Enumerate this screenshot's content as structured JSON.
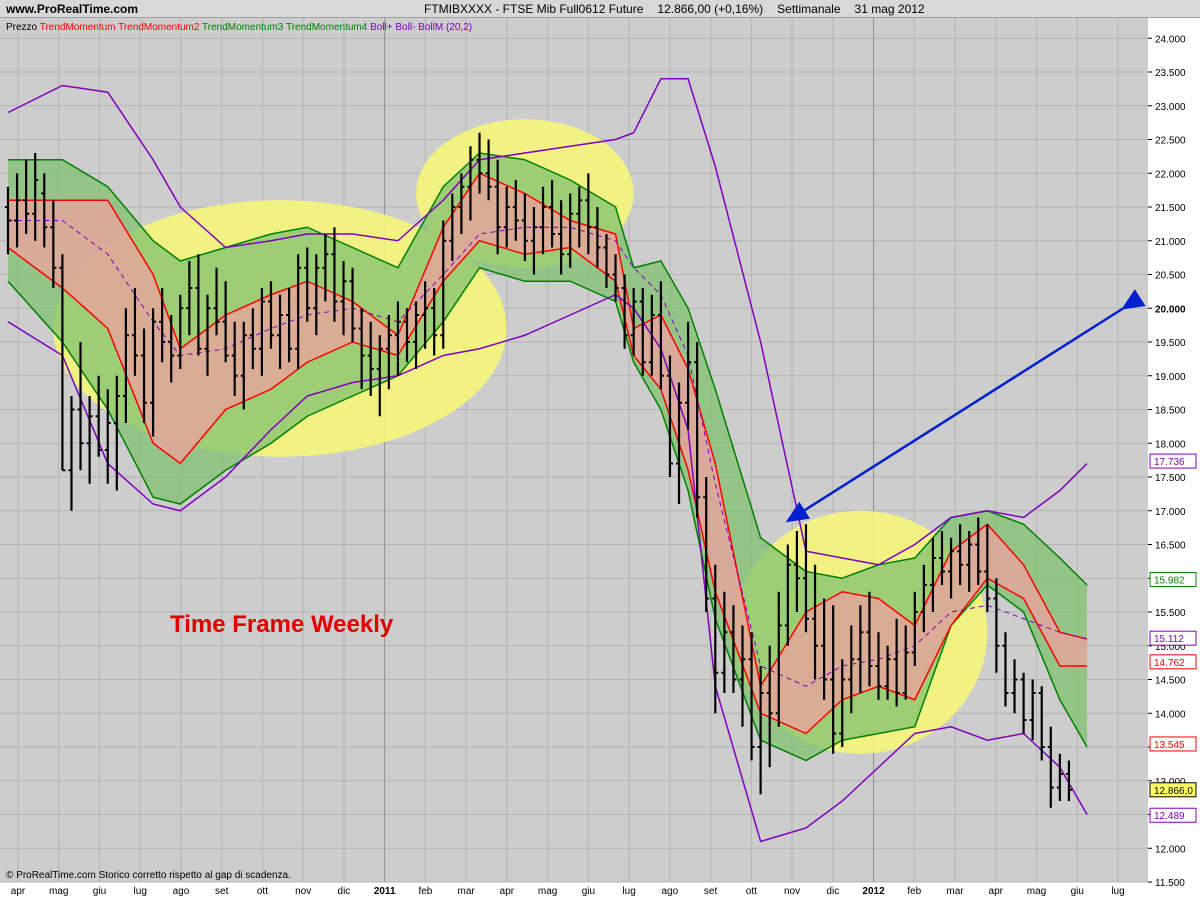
{
  "header": {
    "site": "www.ProRealTime.com",
    "symbol": "FTMIBXXXX - FTSE Mib Full0612 Future",
    "price": "12.866,00 (+0,16%)",
    "timeframe": "Settimanale",
    "date": "31 mag 2012"
  },
  "legend": [
    {
      "text": "Prezzo",
      "color": "#000000"
    },
    {
      "text": "TrendMomentum",
      "color": "#ff0000"
    },
    {
      "text": "TrendMomentum2",
      "color": "#ff0000"
    },
    {
      "text": "TrendMomentum3",
      "color": "#008000"
    },
    {
      "text": "TrendMomentum4",
      "color": "#008000"
    },
    {
      "text": "Boll+",
      "color": "#8000c0"
    },
    {
      "text": "Boll-",
      "color": "#8000c0"
    },
    {
      "text": "BollM (20,2)",
      "color": "#8000c0"
    }
  ],
  "annotation": {
    "text": "Time Frame Weekly",
    "color": "#e00000"
  },
  "footer": "© ProRealTime.com  Storico corretto rispetto al gap di scadenza.",
  "colors": {
    "background": "#cdcdcd",
    "bars": "#000000",
    "red_band": "#f0a0a0",
    "green_band": "#80c070",
    "red_line": "#ff0000",
    "green_line": "#008000",
    "bollinger": "#8000c0",
    "highlight": "#f6f67a",
    "arrow": "#0020d0"
  },
  "chart_data": {
    "type": "ohlc-bar",
    "ylim": [
      11500,
      24300
    ],
    "y_ticks": [
      "24.000",
      "23.500",
      "23.000",
      "22.500",
      "22.000",
      "21.500",
      "21.000",
      "20.500",
      "20.000",
      "19.500",
      "19.000",
      "18.500",
      "18.000",
      "17.500",
      "17.000",
      "16.500",
      "16.000",
      "15.500",
      "15.000",
      "14.500",
      "14.000",
      "13.500",
      "13.000",
      "12.500",
      "12.000",
      "11.500"
    ],
    "x_ticks": [
      "apr",
      "mag",
      "giu",
      "lug",
      "ago",
      "set",
      "ott",
      "nov",
      "dic",
      "2011",
      "feb",
      "mar",
      "apr",
      "mag",
      "giu",
      "lug",
      "ago",
      "set",
      "ott",
      "nov",
      "dic",
      "2012",
      "feb",
      "mar",
      "apr",
      "mag",
      "giu",
      "lug"
    ],
    "price_labels": [
      {
        "text": "17.736",
        "value": 17736,
        "color": "#8000c0"
      },
      {
        "text": "15.982",
        "value": 15982,
        "color": "#008000"
      },
      {
        "text": "15.112",
        "value": 15112,
        "color": "#8000c0"
      },
      {
        "text": "14.762",
        "value": 14762,
        "color": "#ff0000"
      },
      {
        "text": "13.545",
        "value": 13545,
        "color": "#ff0000"
      },
      {
        "text": "12.866,0",
        "value": 12866,
        "color": "#000000"
      },
      {
        "text": "12.489",
        "value": 12489,
        "color": "#8000c0"
      }
    ],
    "bars": [
      [
        21500,
        21800,
        20800,
        21300
      ],
      [
        21300,
        22000,
        20900,
        21600
      ],
      [
        21600,
        22200,
        21100,
        21400
      ],
      [
        21400,
        22300,
        21000,
        21900
      ],
      [
        21700,
        22000,
        20900,
        21200
      ],
      [
        21200,
        21600,
        20300,
        20600
      ],
      [
        20600,
        20800,
        17600,
        17600
      ],
      [
        17600,
        18700,
        17000,
        18500
      ],
      [
        18500,
        19500,
        17600,
        18000
      ],
      [
        18000,
        18700,
        17400,
        18400
      ],
      [
        18400,
        19000,
        17800,
        17900
      ],
      [
        17900,
        18800,
        17400,
        18300
      ],
      [
        18300,
        19000,
        17300,
        18700
      ],
      [
        18700,
        20000,
        18300,
        19600
      ],
      [
        19600,
        20300,
        19000,
        19300
      ],
      [
        19300,
        19700,
        18300,
        18600
      ],
      [
        18600,
        20000,
        18100,
        19800
      ],
      [
        19800,
        20300,
        19200,
        19500
      ],
      [
        19500,
        19900,
        18900,
        19300
      ],
      [
        19300,
        20200,
        19100,
        20000
      ],
      [
        20000,
        20700,
        19600,
        20300
      ],
      [
        20300,
        20800,
        19300,
        19400
      ],
      [
        19400,
        20200,
        19000,
        20000
      ],
      [
        20000,
        20600,
        19600,
        19800
      ],
      [
        19800,
        20400,
        19200,
        19300
      ],
      [
        19300,
        19800,
        18700,
        19000
      ],
      [
        19000,
        19800,
        18500,
        19600
      ],
      [
        19600,
        20000,
        19100,
        19400
      ],
      [
        19400,
        20300,
        19000,
        20100
      ],
      [
        20100,
        20400,
        19400,
        19600
      ],
      [
        19600,
        20200,
        19100,
        19900
      ],
      [
        19900,
        20300,
        19200,
        19400
      ],
      [
        19400,
        20800,
        19100,
        20600
      ],
      [
        20600,
        20900,
        19800,
        20000
      ],
      [
        20000,
        20800,
        19600,
        20600
      ],
      [
        20600,
        21100,
        20100,
        20800
      ],
      [
        20800,
        21200,
        19800,
        20100
      ],
      [
        20100,
        20700,
        19600,
        20400
      ],
      [
        20400,
        20600,
        19500,
        19700
      ],
      [
        19700,
        20000,
        18800,
        19300
      ],
      [
        19300,
        19800,
        18700,
        19100
      ],
      [
        19100,
        19600,
        18400,
        19400
      ],
      [
        19400,
        19900,
        18800,
        19600
      ],
      [
        19600,
        20100,
        19000,
        19800
      ],
      [
        19800,
        20000,
        19200,
        19500
      ],
      [
        19500,
        20100,
        19100,
        19900
      ],
      [
        19900,
        20400,
        19400,
        20000
      ],
      [
        20000,
        20300,
        19300,
        19600
      ],
      [
        19600,
        21300,
        19400,
        21000
      ],
      [
        21000,
        21700,
        20700,
        21500
      ],
      [
        21500,
        22000,
        21100,
        21800
      ],
      [
        21800,
        22400,
        21300,
        22200
      ],
      [
        22200,
        22600,
        21700,
        22000
      ],
      [
        22000,
        22500,
        21600,
        21800
      ],
      [
        21800,
        22200,
        20800,
        21200
      ],
      [
        21200,
        21800,
        20900,
        21500
      ],
      [
        21500,
        21900,
        21000,
        21300
      ],
      [
        21300,
        21700,
        20700,
        21000
      ],
      [
        21000,
        21500,
        20500,
        21200
      ],
      [
        21200,
        21800,
        20800,
        21500
      ],
      [
        21500,
        21900,
        20900,
        21100
      ],
      [
        21100,
        21600,
        20500,
        20800
      ],
      [
        20800,
        21700,
        20600,
        21400
      ],
      [
        21400,
        21800,
        20900,
        21600
      ],
      [
        21600,
        22000,
        20800,
        21200
      ],
      [
        21200,
        21500,
        20600,
        20900
      ],
      [
        20900,
        21100,
        20300,
        20500
      ],
      [
        20500,
        20800,
        20100,
        20300
      ],
      [
        20300,
        20500,
        19400,
        19600
      ],
      [
        19600,
        20300,
        19300,
        20100
      ],
      [
        20100,
        20300,
        19000,
        19200
      ],
      [
        19200,
        20200,
        19000,
        19900
      ],
      [
        19900,
        20400,
        18800,
        19000
      ],
      [
        19000,
        19300,
        17500,
        17700
      ],
      [
        17700,
        18900,
        17100,
        18600
      ],
      [
        18600,
        19800,
        18200,
        19200
      ],
      [
        19200,
        19500,
        16900,
        17200
      ],
      [
        17200,
        17500,
        15500,
        15700
      ],
      [
        15700,
        16200,
        14000,
        14600
      ],
      [
        14600,
        15800,
        14300,
        15200
      ],
      [
        15200,
        15600,
        14300,
        14500
      ],
      [
        14500,
        15300,
        13800,
        14800
      ],
      [
        14800,
        15200,
        13300,
        13500
      ],
      [
        13500,
        14700,
        12800,
        14300
      ],
      [
        14300,
        15000,
        13200,
        14000
      ],
      [
        14000,
        15800,
        13800,
        15300
      ],
      [
        15300,
        16500,
        15000,
        16200
      ],
      [
        16200,
        16700,
        15500,
        16000
      ],
      [
        16000,
        16800,
        15200,
        15400
      ],
      [
        15400,
        16200,
        14500,
        15000
      ],
      [
        15000,
        15700,
        14200,
        14500
      ],
      [
        14500,
        15600,
        13400,
        13700
      ],
      [
        13700,
        14800,
        13500,
        14500
      ],
      [
        14500,
        15300,
        14000,
        14800
      ],
      [
        14800,
        15600,
        14300,
        15200
      ],
      [
        15200,
        15800,
        14400,
        14700
      ],
      [
        14700,
        15200,
        14200,
        14400
      ],
      [
        14400,
        15000,
        14200,
        14800
      ],
      [
        14800,
        15400,
        14100,
        14300
      ],
      [
        14300,
        15300,
        14200,
        14900
      ],
      [
        14900,
        15800,
        14700,
        15500
      ],
      [
        15500,
        16200,
        15200,
        15900
      ],
      [
        15900,
        16600,
        15500,
        16300
      ],
      [
        16300,
        16700,
        15900,
        16100
      ],
      [
        16100,
        16600,
        15700,
        16400
      ],
      [
        16400,
        16800,
        15900,
        16200
      ],
      [
        16200,
        16700,
        15800,
        16500
      ],
      [
        16500,
        16900,
        15900,
        16100
      ],
      [
        16100,
        16800,
        15500,
        15700
      ],
      [
        15700,
        16000,
        14600,
        15000
      ],
      [
        15000,
        15200,
        14100,
        14300
      ],
      [
        14300,
        14800,
        14000,
        14500
      ],
      [
        14500,
        14600,
        13700,
        13900
      ],
      [
        13900,
        14500,
        13600,
        14300
      ],
      [
        14300,
        14400,
        13300,
        13500
      ],
      [
        13500,
        13800,
        12600,
        12900
      ],
      [
        12900,
        13400,
        12700,
        13100
      ],
      [
        13100,
        13300,
        12700,
        12866
      ]
    ],
    "bands": {
      "x_steps": [
        0,
        6,
        11,
        16,
        19,
        24,
        29,
        33,
        38,
        43,
        48,
        52,
        57,
        62,
        67,
        69,
        72,
        75,
        78,
        83,
        88,
        92,
        96,
        100,
        104,
        108,
        112,
        116,
        119
      ],
      "red_upper": [
        21600,
        21600,
        21600,
        20500,
        19400,
        19900,
        20200,
        20400,
        20100,
        19600,
        21200,
        22000,
        21700,
        21300,
        21100,
        19700,
        19900,
        19100,
        17700,
        14400,
        15500,
        15800,
        15700,
        15300,
        16400,
        16800,
        16200,
        15200,
        15100
      ],
      "red_lower": [
        20900,
        20300,
        19700,
        18000,
        17700,
        18500,
        18800,
        19200,
        19500,
        19300,
        20400,
        21000,
        20800,
        20900,
        20400,
        19300,
        18800,
        17600,
        15800,
        14000,
        13700,
        14200,
        14400,
        14200,
        15300,
        16000,
        15700,
        14700,
        14700
      ],
      "green_upper": [
        22200,
        22200,
        21800,
        21000,
        20700,
        20900,
        21100,
        21200,
        20900,
        20600,
        21800,
        22300,
        22200,
        21900,
        21500,
        20600,
        20700,
        20000,
        18800,
        16600,
        16100,
        16000,
        16200,
        16300,
        16900,
        17000,
        16800,
        16300,
        15900
      ],
      "green_lower": [
        20400,
        19500,
        18500,
        17200,
        17100,
        17600,
        18000,
        18400,
        18700,
        19000,
        19800,
        20600,
        20400,
        20400,
        20100,
        19200,
        18500,
        17300,
        15400,
        13600,
        13300,
        13600,
        13700,
        13800,
        15300,
        15900,
        15500,
        14200,
        13500
      ],
      "boll_upper": [
        22900,
        23300,
        23200,
        22200,
        21500,
        20900,
        21000,
        21100,
        21100,
        21000,
        21600,
        22200,
        22300,
        22400,
        22500,
        22600,
        23400,
        23400,
        22100,
        19500,
        16400,
        16300,
        16200,
        16500,
        16900,
        17000,
        16900,
        17300,
        17700
      ],
      "boll_lower": [
        19800,
        19300,
        17700,
        17100,
        17000,
        17500,
        18200,
        18700,
        18900,
        19000,
        19300,
        19400,
        19600,
        19900,
        20200,
        20000,
        19400,
        18200,
        14400,
        12100,
        12300,
        12700,
        13200,
        13700,
        13800,
        13600,
        13700,
        13200,
        12500
      ],
      "boll_mid": [
        21300,
        21300,
        20800,
        19800,
        19300,
        19400,
        19700,
        19900,
        20000,
        19800,
        20500,
        21100,
        21200,
        21200,
        21000,
        20600,
        20200,
        19300,
        17400,
        14700,
        14400,
        14700,
        14800,
        15000,
        15500,
        15600,
        15400,
        15200,
        15100
      ]
    },
    "highlights": [
      {
        "center_bar": 30,
        "center_y": 19700,
        "rx_bars": 25,
        "ry_value": 1900
      },
      {
        "center_bar": 57,
        "center_y": 21700,
        "rx_bars": 12,
        "ry_value": 1100
      },
      {
        "center_bar": 94,
        "center_y": 15200,
        "rx_bars": 14,
        "ry_value": 1800
      }
    ],
    "arrow": {
      "from": [
        105,
        15300
      ],
      "to": [
        86,
        16850
      ],
      "head2": [
        123,
        20000
      ]
    }
  }
}
